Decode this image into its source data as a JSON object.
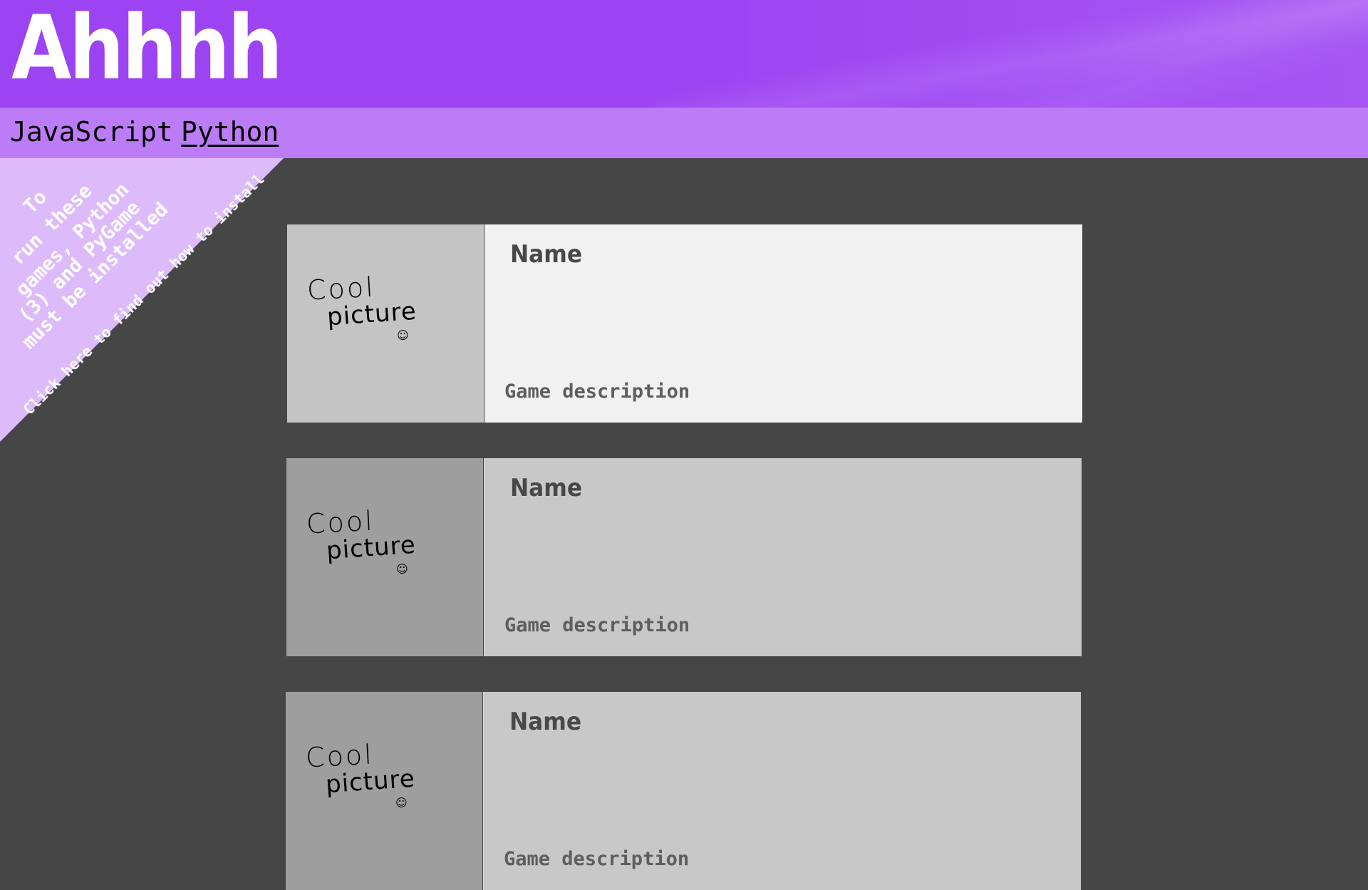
{
  "header": {
    "title": "Ahhhh",
    "background_color": "#9c43f2"
  },
  "nav": {
    "background_color": "#bd7cf7",
    "items": [
      {
        "label": "JavaScript",
        "active": false
      },
      {
        "label": "Python",
        "active": true
      }
    ]
  },
  "corner_notice": {
    "background_color": "#ddbbfb",
    "lines": [
      "To",
      "run these",
      "games, Python",
      "(3) and PyGame",
      "must be installed"
    ],
    "link_text": "Click here to find out how to install"
  },
  "games": [
    {
      "picture_text": [
        "Cool",
        "picture",
        "☺"
      ],
      "name": "Name",
      "description": "Game description",
      "highlighted": true
    },
    {
      "picture_text": [
        "Cool",
        "picture",
        "☺"
      ],
      "name": "Name",
      "description": "Game description",
      "highlighted": false
    },
    {
      "picture_text": [
        "Cool",
        "picture",
        "☺"
      ],
      "name": "Name",
      "description": "Game description",
      "highlighted": false
    }
  ],
  "colors": {
    "page_background": "#464646",
    "card_highlight_body": "#f1f1f1",
    "card_body": "#c8c8c8",
    "card_thumb": "#9e9e9e"
  }
}
